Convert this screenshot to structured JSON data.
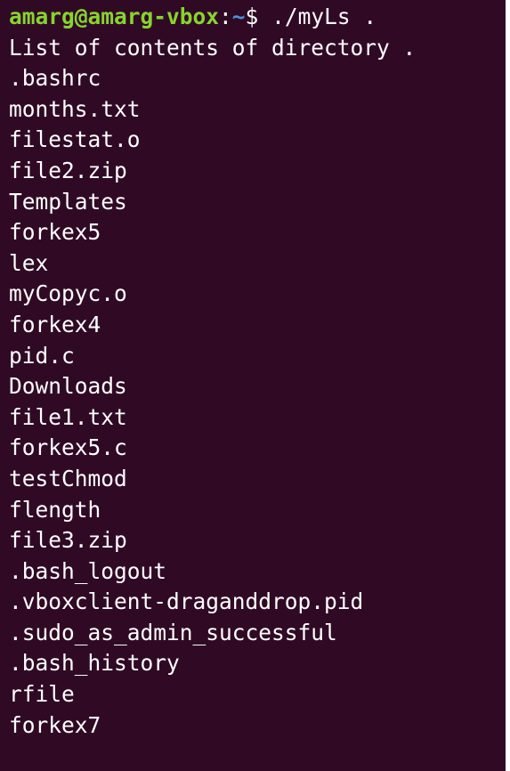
{
  "terminal": {
    "prompt": {
      "user_host": "amarg@amarg-vbox",
      "separator": ":",
      "path": "~",
      "symbol": "$ ",
      "command": "./myLs ."
    },
    "header_line": "List of contents of directory .",
    "entries": [
      ".bashrc",
      "months.txt",
      "filestat.o",
      "file2.zip",
      "Templates",
      "forkex5",
      "lex",
      "myCopyc.o",
      "forkex4",
      "pid.c",
      "Downloads",
      "file1.txt",
      "forkex5.c",
      "testChmod",
      "flength",
      "file3.zip",
      ".bash_logout",
      ".vboxclient-draganddrop.pid",
      ".sudo_as_admin_successful",
      ".bash_history",
      "rfile",
      "forkex7"
    ],
    "colors": {
      "background": "#300a24",
      "text": "#ffffff",
      "user_host": "#87d42f",
      "path": "#4d8fdc"
    }
  }
}
